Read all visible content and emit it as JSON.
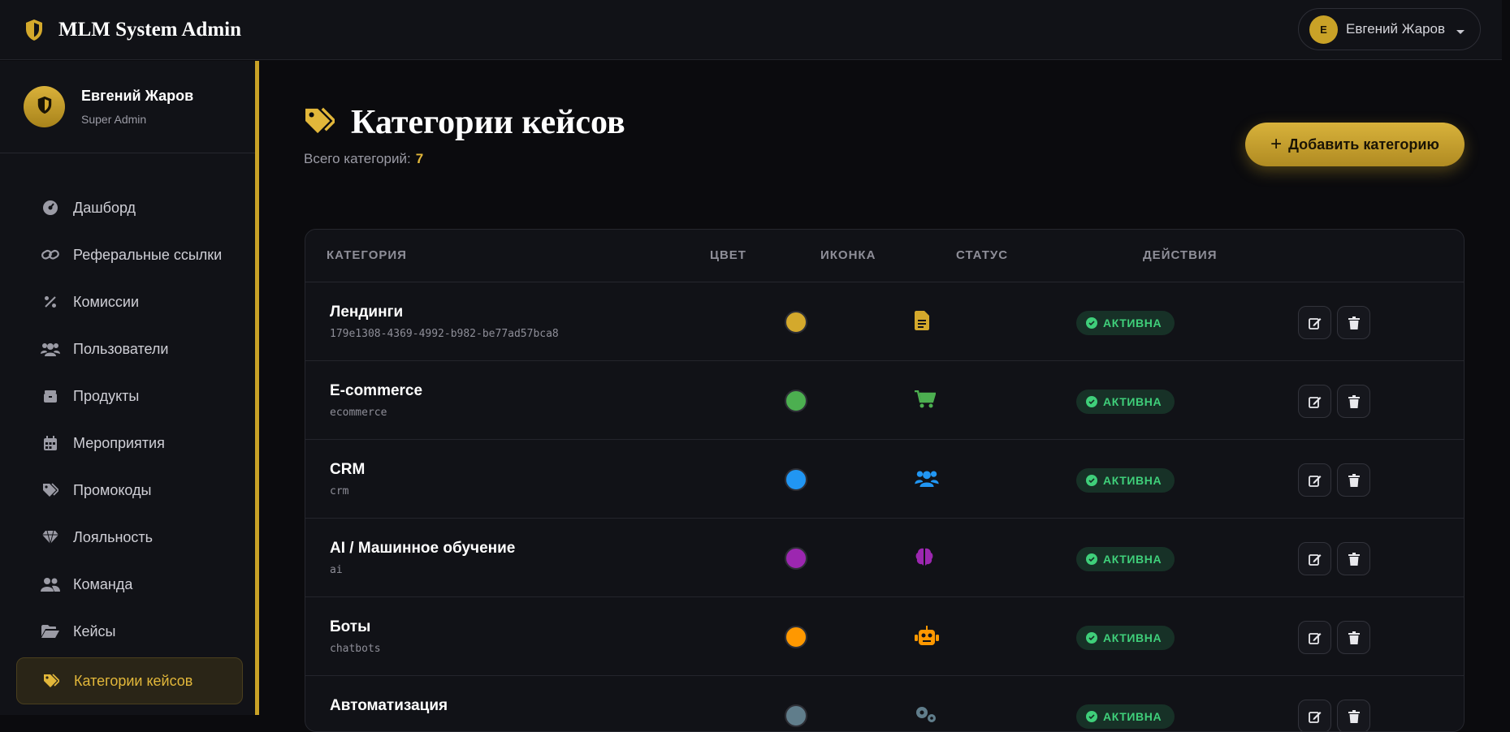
{
  "app": {
    "brand": "MLM System Admin"
  },
  "header": {
    "user_initial": "Е",
    "user_name": "Евгений Жаров"
  },
  "sidebar": {
    "profile": {
      "name": "Евгений Жаров",
      "role": "Super Admin"
    },
    "items": [
      {
        "label": "Дашборд",
        "icon": "dashboard-icon",
        "active": false
      },
      {
        "label": "Реферальные ссылки",
        "icon": "link-icon",
        "active": false
      },
      {
        "label": "Комиссии",
        "icon": "percent-icon",
        "active": false
      },
      {
        "label": "Пользователи",
        "icon": "users-icon",
        "active": false
      },
      {
        "label": "Продукты",
        "icon": "box-icon",
        "active": false
      },
      {
        "label": "Мероприятия",
        "icon": "calendar-icon",
        "active": false
      },
      {
        "label": "Промокоды",
        "icon": "tags-icon",
        "active": false
      },
      {
        "label": "Лояльность",
        "icon": "gem-icon",
        "active": false
      },
      {
        "label": "Команда",
        "icon": "team-icon",
        "active": false
      },
      {
        "label": "Кейсы",
        "icon": "folder-open-icon",
        "active": false
      },
      {
        "label": "Категории кейсов",
        "icon": "tags-icon",
        "active": true
      }
    ]
  },
  "page": {
    "title": "Категории кейсов",
    "subtitle_label": "Всего категорий:",
    "count": "7",
    "add_button": "Добавить категорию"
  },
  "table": {
    "columns": [
      "КАТЕГОРИЯ",
      "ЦВЕТ",
      "ИКОНКА",
      "СТАТУС",
      "ДЕЙСТВИЯ"
    ],
    "rows": [
      {
        "name": "Лендинги",
        "slug": "179e1308-4369-4992-b982-be77ad57bca8",
        "color": "#d4a92c",
        "icon": "file-alt-icon",
        "status": "АКТИВНА"
      },
      {
        "name": "E-commerce",
        "slug": "ecommerce",
        "color": "#4caf50",
        "icon": "shopping-cart-icon",
        "status": "АКТИВНА"
      },
      {
        "name": "CRM",
        "slug": "crm",
        "color": "#2196f3",
        "icon": "users-icon",
        "status": "АКТИВНА"
      },
      {
        "name": "AI / Машинное обучение",
        "slug": "ai",
        "color": "#9c27b0",
        "icon": "brain-icon",
        "status": "АКТИВНА"
      },
      {
        "name": "Боты",
        "slug": "chatbots",
        "color": "#ff9800",
        "icon": "robot-icon",
        "status": "АКТИВНА"
      },
      {
        "name": "Автоматизация",
        "slug": "",
        "color": "#607d8b",
        "icon": "cogs-icon",
        "status": "АКТИВНА"
      }
    ]
  }
}
